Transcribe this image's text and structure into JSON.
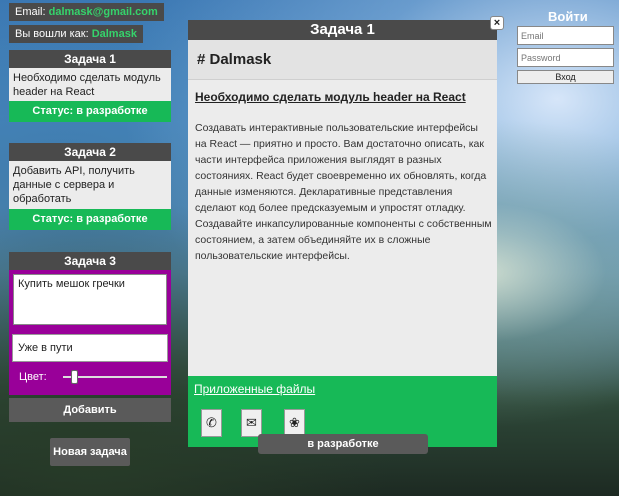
{
  "user_info": {
    "email_label": "Email: ",
    "email": "dalmask@gmail.com",
    "logged_label": "Вы вошли как: ",
    "username": "Dalmask"
  },
  "tasks": [
    {
      "title": "Задача 1",
      "body": "Необходимо сделать модуль header на React",
      "status": "Статус: в разработке"
    },
    {
      "title": "Задача 2",
      "body": "Добавить API, получить данные с сервера и обработать",
      "status": "Статус: в разработке"
    }
  ],
  "new_task_form": {
    "title": "Задача 3",
    "textarea_value": "Купить мешок гречки",
    "status_value": "Уже в пути",
    "color_label": "Цвет:",
    "color_level": 0.1,
    "add_button": "Добавить"
  },
  "new_task_button": "Новая задача",
  "modal": {
    "title": "Задача 1",
    "close": "×",
    "user": "# Dalmask",
    "heading": "Необходимо сделать модуль header на React",
    "description": "Создавать интерактивные пользовательские интерфейсы на React — приятно и просто. Вам достаточно описать, как части интерфейса приложения выглядят в разных состояниях. React будет своевременно их обновлять, когда данные изменяются. Декларативные представления сделают код более предсказуемым и упростят отладку. Создавайте инкапсулированные компоненты с собственным состоянием, а затем объединяйте их в сложные пользовательские интерфейсы.",
    "files_label": "Приложенные файлы",
    "file_icons": [
      "telephone-icon",
      "envelope-icon",
      "flower-icon"
    ],
    "file_glyphs": [
      "✆",
      "✉",
      "❀"
    ],
    "status_button": "в разработке"
  },
  "login": {
    "title": "Войти",
    "email_placeholder": "Email",
    "password_placeholder": "Password",
    "submit": "Вход"
  },
  "colors": {
    "accent_green": "#17b957",
    "form_purple": "#990099",
    "dark_header": "#4a4a4a"
  }
}
